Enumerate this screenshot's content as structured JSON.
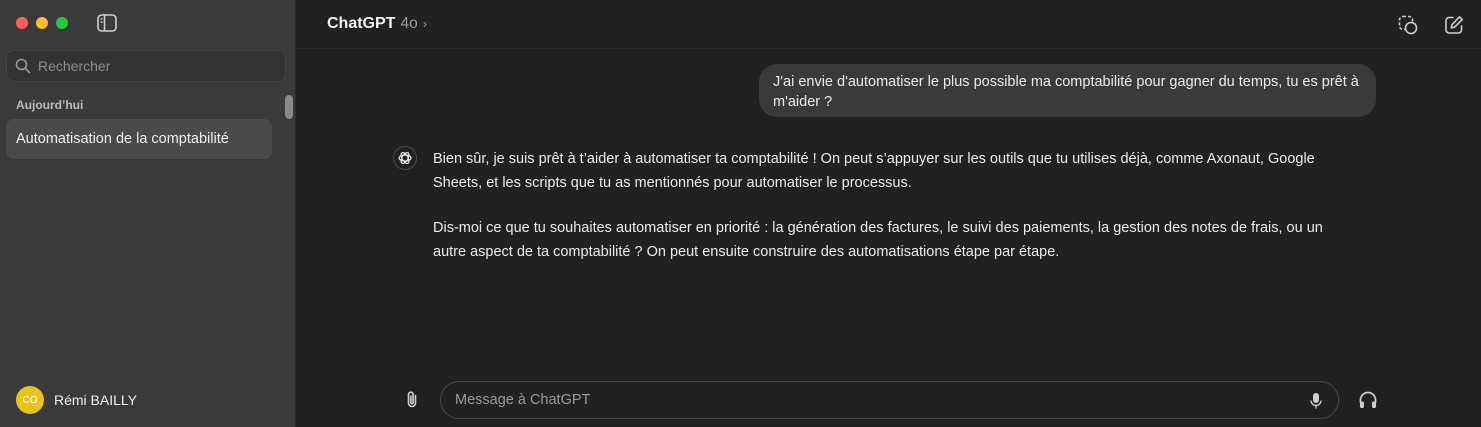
{
  "window": {
    "traffic_lights": [
      "close",
      "minimize",
      "maximize"
    ]
  },
  "sidebar": {
    "toggle_icon": "sidebar-toggle-icon",
    "search_placeholder": "Rechercher",
    "section_label": "Aujourd’hui",
    "conversations": [
      {
        "title": "Automatisation de la comptabilité"
      }
    ],
    "user": {
      "avatar_initials": "CO",
      "avatar_color": "#e8c31a",
      "name": "Rémi BAILLY"
    }
  },
  "header": {
    "model_name": "ChatGPT",
    "model_version": "4o",
    "chevron": "›",
    "icons": [
      "temporary-chat-icon",
      "new-chat-icon"
    ]
  },
  "conversation": {
    "user_message": "J'ai envie d'automatiser le plus possible ma comptabilité pour gagner du temps, tu es prêt à m'aider ?",
    "assistant_paragraphs": [
      "Bien sûr, je suis prêt à t’aider à automatiser ta comptabilité ! On peut s’appuyer sur les outils que tu utilises déjà, comme Axonaut, Google Sheets, et les scripts que tu as mentionnés pour automatiser le processus.",
      "Dis-moi ce que tu souhaites automatiser en priorité : la génération des factures, le suivi des paiements, la gestion des notes de frais, ou un autre aspect de ta comptabilité ? On peut ensuite construire des automatisations étape par étape."
    ]
  },
  "composer": {
    "placeholder": "Message à ChatGPT",
    "icons": [
      "attach-icon",
      "mic-icon",
      "headphones-icon"
    ]
  },
  "colors": {
    "sidebar_bg": "#3a3a3a",
    "main_bg": "#212121",
    "bubble_bg": "#3a3a3a",
    "selected_item_bg": "#4a4a4a"
  }
}
